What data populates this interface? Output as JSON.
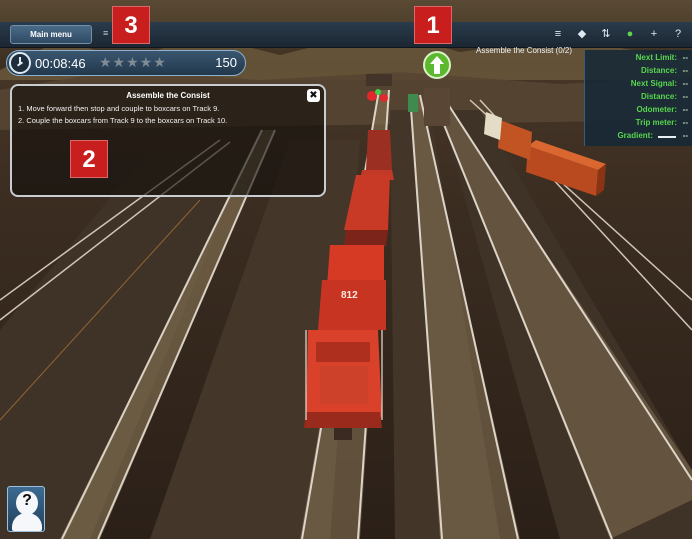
{
  "top_bar": {
    "main_menu_label": "Main menu",
    "dots": "≡",
    "icons": [
      "menu-icon",
      "eye-icon",
      "sort-icon",
      "green-light-icon",
      "plus-icon",
      "help-icon"
    ],
    "icon_glyphs": [
      "≡",
      "◆",
      "⇅",
      "●",
      "+",
      "?"
    ]
  },
  "callouts": [
    "1",
    "2",
    "3"
  ],
  "timer": {
    "time": "00:08:46",
    "stars": "★★★★★",
    "stars_filled": 0,
    "stars_total": 5,
    "score": "150"
  },
  "objective_title": "Assemble the Consist (0/2)",
  "hud": {
    "rows": [
      {
        "label": "Next Limit:",
        "value": "--"
      },
      {
        "label": "Distance:",
        "value": "--"
      },
      {
        "label": "Next Signal:",
        "value": "--"
      },
      {
        "label": "Distance:",
        "value": "--"
      },
      {
        "label": "Odometer:",
        "value": "--"
      },
      {
        "label": "Trip meter:",
        "value": "--"
      },
      {
        "label": "Gradient:",
        "value": "--"
      }
    ]
  },
  "dialog": {
    "title": "Assemble the Consist",
    "close": "✖",
    "steps": [
      "1. Move forward then stop and couple to boxcars on Track 9.",
      "2. Couple the boxcars from Track 9 to the boxcars on Track 10."
    ]
  },
  "loco_number": "812",
  "help": {
    "glyph": "?"
  },
  "colors": {
    "hud_label": "#57d64e",
    "callout": "#c81e1e",
    "locomotive": "#d63a25",
    "boxcar": "#c25322"
  }
}
